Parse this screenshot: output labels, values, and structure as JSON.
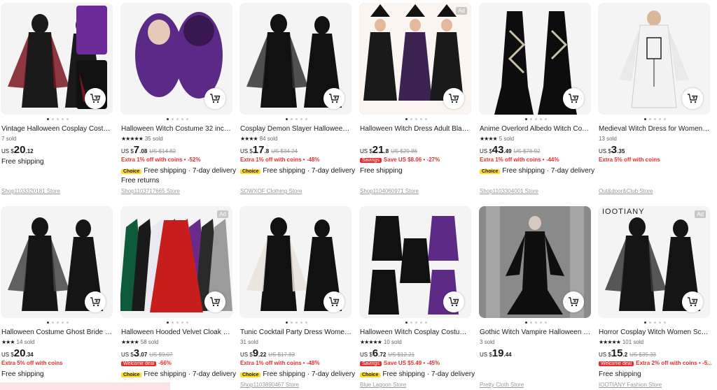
{
  "products": [
    {
      "title": "Vintage Halloween Cosplay Costum...",
      "sold": "7 sold",
      "stars": "",
      "cur": "US $",
      "price_int": "20",
      "price_dec": ".12",
      "old": "",
      "line1": "",
      "line1_tag": "",
      "line1_kind": "",
      "ship": "Free shipping",
      "ship2": "",
      "choice": "",
      "store": "Shop1103320181 Store",
      "ad": "",
      "colors": [
        "#1a1a1a",
        "#7a1620"
      ]
    },
    {
      "title": "Halloween Witch Costume 32 inch ...",
      "sold": "35 sold",
      "stars": "★★★★★",
      "cur": "US $",
      "price_int": "7",
      "price_dec": ".08",
      "old": "US $14.82",
      "line1": "Extra 1% off with coins • -52%",
      "line1_tag": "",
      "line1_kind": "red",
      "ship": "Free shipping · 7-day delivery",
      "ship2": "Free returns",
      "choice": "Choice",
      "store": "Shop1103717665 Store",
      "ad": "",
      "colors": [
        "#5b2a86",
        "#3a1650"
      ]
    },
    {
      "title": "Cosplay Demon Slayer Halloween C...",
      "sold": "84 sold",
      "stars": "★★★★",
      "cur": "US $",
      "price_int": "17",
      "price_dec": ".8",
      "old": "US $34.24",
      "line1": "Extra 1% off with coins • -48%",
      "line1_tag": "",
      "line1_kind": "red",
      "ship": "Free shipping · 7-day delivery",
      "ship2": "",
      "choice": "Choice",
      "store": "SOWXOF Clothing Store",
      "ad": "",
      "colors": [
        "#111",
        "#333"
      ]
    },
    {
      "title": "Halloween Witch Dress Adult Black ...",
      "sold": "",
      "stars": "",
      "cur": "US $",
      "price_int": "21",
      "price_dec": ".8",
      "old": "US $29.86",
      "line1": "Save US $8.06 • -27%",
      "line1_tag": "Savings",
      "line1_kind": "red",
      "ship": "Free shipping",
      "ship2": "",
      "choice": "",
      "store": "Shop1104060971 Store",
      "ad": "Ad",
      "colors": [
        "#1a1a1a",
        "#3b2250"
      ]
    },
    {
      "title": "Anime Overlord Albedo Witch Cospl...",
      "sold": "5 sold",
      "stars": "★★★★",
      "cur": "US $",
      "price_int": "43",
      "price_dec": ".49",
      "old": "US $78.92",
      "line1": "Extra 1% off with coins • -44%",
      "line1_tag": "",
      "line1_kind": "red",
      "ship": "Free shipping · 7-day delivery",
      "ship2": "",
      "choice": "Choice",
      "store": "Shop1103304001 Store",
      "ad": "",
      "colors": [
        "#0d0d0d",
        "#c8c0a8"
      ]
    },
    {
      "title": "Medieval Witch Dress for Women V...",
      "sold": "13 sold",
      "stars": "",
      "cur": "US $",
      "price_int": "3",
      "price_dec": ".35",
      "old": "",
      "line1": "Extra 5% off with coins",
      "line1_tag": "",
      "line1_kind": "red",
      "ship": "",
      "ship2": "",
      "choice": "",
      "store": "Out&door&Club Store",
      "ad": "",
      "colors": [
        "#f2f2f2",
        "#222"
      ]
    },
    {
      "title": "Halloween Costume Ghost Bride Wi...",
      "sold": "14 sold",
      "stars": "★★★",
      "cur": "US $",
      "price_int": "20",
      "price_dec": ".34",
      "old": "",
      "line1": "Extra 5% off with coins",
      "line1_tag": "",
      "line1_kind": "red",
      "ship": "Free shipping",
      "ship2": "",
      "choice": "",
      "store": "",
      "ad": "",
      "colors": [
        "#151515",
        "#444"
      ]
    },
    {
      "title": "Halloween Hooded Velvet Cloak Ro...",
      "sold": "58 sold",
      "stars": "★★★★",
      "cur": "US $",
      "price_int": "3",
      "price_dec": ".07",
      "old": "US $9.07",
      "line1": "-66%",
      "line1_tag": "Welcome deal",
      "line1_kind": "red",
      "ship": "Free shipping · 7-day delivery",
      "ship2": "",
      "choice": "Choice",
      "store": "",
      "ad": "Ad",
      "colors": [
        "#c81d1d",
        "#1d3fa8"
      ]
    },
    {
      "title": "Tunic Cocktail Party Dress Women E...",
      "sold": "31 sold",
      "stars": "",
      "cur": "US $",
      "price_int": "9",
      "price_dec": ".22",
      "old": "US $17.83",
      "line1": "Extra 1% off with coins • -48%",
      "line1_tag": "",
      "line1_kind": "red",
      "ship": "Free shipping · 7-day delivery",
      "ship2": "",
      "choice": "Choice",
      "store": "Shop1103890467 Store",
      "ad": "",
      "colors": [
        "#111",
        "#e8e2da"
      ]
    },
    {
      "title": "Halloween Witch Cosplay Costumes...",
      "sold": "10 sold",
      "stars": "★★★★★",
      "cur": "US $",
      "price_int": "6",
      "price_dec": ".72",
      "old": "US $12.21",
      "line1": "Save US $5.49 • -45%",
      "line1_tag": "Savings",
      "line1_kind": "red",
      "ship": "Free shipping · 7-day delivery",
      "ship2": "",
      "choice": "Choice",
      "store": "Blue Lagoon Store",
      "ad": "",
      "colors": [
        "#111",
        "#5d2b86"
      ]
    },
    {
      "title": "Gothic Witch Vampire Halloween Dr...",
      "sold": "3 sold",
      "stars": "",
      "cur": "US $",
      "price_int": "19",
      "price_dec": ".44",
      "old": "",
      "line1": "",
      "line1_tag": "",
      "line1_kind": "",
      "ship": "",
      "ship2": "",
      "choice": "",
      "store": "Pretty Cloth Store",
      "ad": "",
      "colors": [
        "#0f0f0f",
        "#bdbdbd"
      ]
    },
    {
      "title": "Horror Cosplay Witch Women Scary...",
      "sold": "101 sold",
      "stars": "★★★★★",
      "cur": "US $",
      "price_int": "15",
      "price_dec": ".2",
      "old": "US $35.33",
      "line1": "Extra 2% off with coins • -5...",
      "line1_tag": "Welcome deal",
      "line1_kind": "red",
      "ship": "Free shipping",
      "ship2": "",
      "choice": "",
      "store": "IOOTIANY Fashion Store",
      "ad": "Ad",
      "colors": [
        "#151515",
        "#3a3a3a"
      ],
      "brand": "IOOTIANY"
    }
  ]
}
